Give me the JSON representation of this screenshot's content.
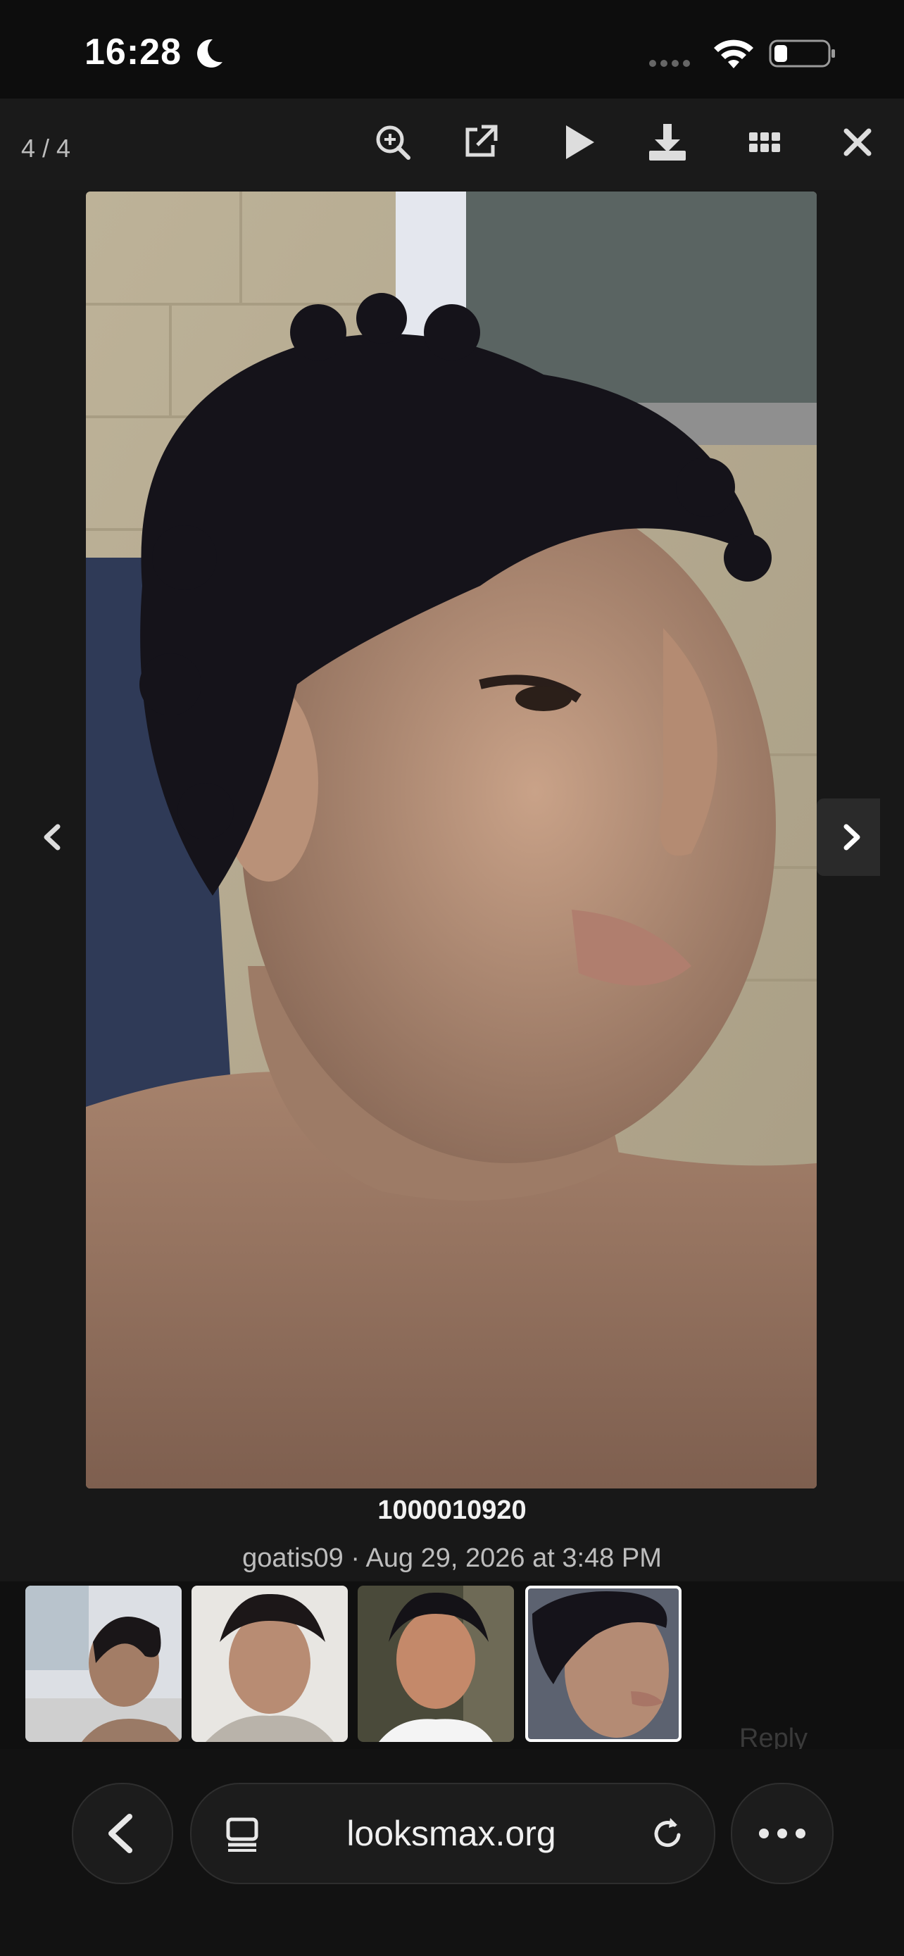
{
  "status_bar": {
    "time": "16:28",
    "icons": [
      "moon-icon",
      "signal-dots-icon",
      "wifi-icon",
      "battery-icon"
    ]
  },
  "lightbox": {
    "counter": "4 / 4",
    "toolbar_icons": [
      "zoom-in-icon",
      "open-external-icon",
      "play-icon",
      "download-icon",
      "grid-icon",
      "close-icon"
    ],
    "nav_icons": [
      "chevron-left-icon",
      "chevron-right-icon"
    ],
    "caption": {
      "title": "1000010920",
      "meta": "goatis09 · Aug 29, 2026 at 3:48 PM"
    },
    "thumbnails_count": 4,
    "active_thumbnail": 4
  },
  "background_page": {
    "reply_label": "Reply"
  },
  "browser": {
    "url": "looksmax.org",
    "icons": [
      "back-chevron-icon",
      "tabs-icon",
      "reload-icon",
      "more-dots-icon"
    ]
  },
  "colors": {
    "background": "#141414",
    "accent_white": "#ffffff",
    "muted_text": "#bdbdbd"
  }
}
